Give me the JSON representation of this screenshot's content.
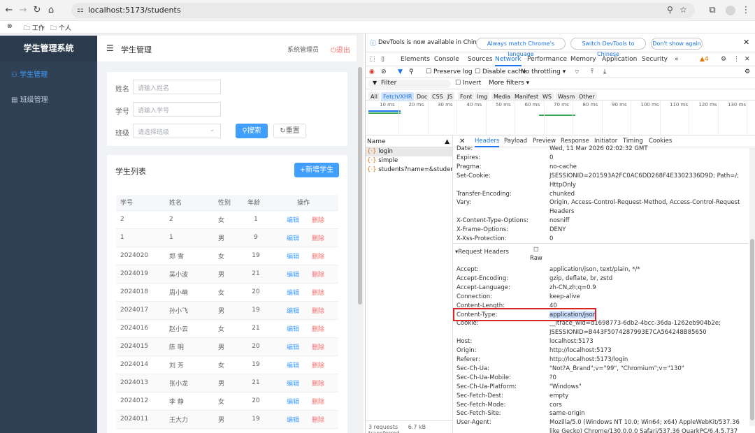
{
  "browser": {
    "url": "localhost:5173/students",
    "bookmarks": [
      "工作",
      "个人"
    ]
  },
  "app": {
    "system_title": "学生管理系统",
    "menu": [
      {
        "label": "学生管理",
        "icon": "user-icon",
        "active": true
      },
      {
        "label": "班级管理",
        "icon": "class-icon",
        "active": false
      }
    ],
    "header_title": "学生管理",
    "admin": "系统管理员",
    "logout": "退出",
    "search": {
      "name_label": "姓名",
      "name_placeholder": "请输入姓名",
      "id_label": "学号",
      "id_placeholder": "请输入学号",
      "class_label": "班级",
      "class_placeholder": "请选择班级",
      "search_btn": "搜索",
      "reset_btn": "重置"
    },
    "list_title": "学生列表",
    "add_btn": "+新增学生",
    "columns": [
      "学号",
      "姓名",
      "性别",
      "年龄",
      "操作"
    ],
    "edit_label": "编辑",
    "delete_label": "删除",
    "rows": [
      [
        "2",
        "2",
        "女",
        "1"
      ],
      [
        "1",
        "1",
        "男",
        "9"
      ],
      [
        "2024020",
        "郑 雪",
        "女",
        "19"
      ],
      [
        "2024019",
        "吴小波",
        "男",
        "21"
      ],
      [
        "2024018",
        "周小萌",
        "女",
        "20"
      ],
      [
        "2024017",
        "孙小飞",
        "男",
        "19"
      ],
      [
        "2024016",
        "赵小云",
        "女",
        "21"
      ],
      [
        "2024015",
        "陈 明",
        "男",
        "20"
      ],
      [
        "2024014",
        "刘 芳",
        "女",
        "19"
      ],
      [
        "2024013",
        "张小龙",
        "男",
        "21"
      ],
      [
        "2024012",
        "李 静",
        "女",
        "20"
      ],
      [
        "2024011",
        "王大力",
        "男",
        "19"
      ]
    ]
  },
  "devtools": {
    "notice": "DevTools is now available in Chinese!",
    "notice_btns": [
      "Always match Chrome's language",
      "Switch DevTools to Chinese",
      "Don't show again"
    ],
    "tabs": [
      "Elements",
      "Console",
      "Sources",
      "Network",
      "Performance",
      "Memory",
      "Application",
      "Security"
    ],
    "active_tab": "Network",
    "warn_count": "4",
    "preserve_log": "Preserve log",
    "disable_cache": "Disable cache",
    "throttling": "No throttling",
    "filter_placeholder": "Filter",
    "invert": "Invert",
    "more_filters": "More filters",
    "types": [
      "All",
      "Fetch/XHR",
      "Doc",
      "CSS",
      "JS",
      "Font",
      "Img",
      "Media",
      "Manifest",
      "WS",
      "Wasm",
      "Other"
    ],
    "timeline_ticks": [
      "10 ms",
      "20 ms",
      "30 ms",
      "40 ms",
      "50 ms",
      "60 ms",
      "70 ms",
      "80 ms",
      "90 ms",
      "100 ms",
      "110 ms",
      "120 ms",
      "130 ms"
    ],
    "name_header": "Name",
    "requests": [
      "login",
      "simple",
      "students?name=&studentN..."
    ],
    "status": {
      "count": "3 requests",
      "transferred": "6.7 kB transferred"
    },
    "detail_tabs": [
      "Headers",
      "Payload",
      "Preview",
      "Response",
      "Initiator",
      "Timing",
      "Cookies"
    ],
    "response_headers": [
      [
        "Date:",
        "Wed, 11 Mar 2026 02:02:32 GMT"
      ],
      [
        "Expires:",
        "0"
      ],
      [
        "Pragma:",
        "no-cache"
      ],
      [
        "Set-Cookie:",
        "JSESSIONID=201593A2FC0AC6DD268F4E3302336D9D; Path=/;"
      ],
      [
        "",
        "HttpOnly"
      ],
      [
        "Transfer-Encoding:",
        "chunked"
      ],
      [
        "Vary:",
        "Origin, Access-Control-Request-Method, Access-Control-Request-"
      ],
      [
        "",
        "Headers"
      ],
      [
        "X-Content-Type-Options:",
        "nosniff"
      ],
      [
        "X-Frame-Options:",
        "DENY"
      ],
      [
        "X-Xss-Protection:",
        "0"
      ]
    ],
    "request_section": "▾Request Headers",
    "raw_label": "Raw",
    "request_headers": [
      [
        "Accept:",
        "application/json, text/plain, */*"
      ],
      [
        "Accept-Encoding:",
        "gzip, deflate, br, zstd"
      ],
      [
        "Accept-Language:",
        "zh-CN,zh;q=0.9"
      ],
      [
        "Connection:",
        "keep-alive"
      ],
      [
        "Content-Length:",
        "40"
      ],
      [
        "Content-Type:",
        "application/json"
      ],
      [
        "Cookie:",
        "__itrace_wid=d1698773-6db2-4bcc-36da-1262eb904b2e;"
      ],
      [
        "",
        "JSESSIONID=B443F5074287993E7CA564248B85650"
      ],
      [
        "Host:",
        "localhost:5173"
      ],
      [
        "Origin:",
        "http://localhost:5173"
      ],
      [
        "Referer:",
        "http://localhost:5173/login"
      ],
      [
        "Sec-Ch-Ua:",
        "\"Not?A_Brand\";v=\"99\", \"Chromium\";v=\"130\""
      ],
      [
        "Sec-Ch-Ua-Mobile:",
        "?0"
      ],
      [
        "Sec-Ch-Ua-Platform:",
        "\"Windows\""
      ],
      [
        "Sec-Fetch-Dest:",
        "empty"
      ],
      [
        "Sec-Fetch-Mode:",
        "cors"
      ],
      [
        "Sec-Fetch-Site:",
        "same-origin"
      ],
      [
        "User-Agent:",
        "Mozilla/5.0 (Windows NT 10.0; Win64; x64) AppleWebKit/537.36 (KHTML,"
      ],
      [
        "",
        "like Gecko) Chrome/130.0.0.0 Safari/537.36 QuarkPC/6.4.5.737"
      ]
    ]
  }
}
